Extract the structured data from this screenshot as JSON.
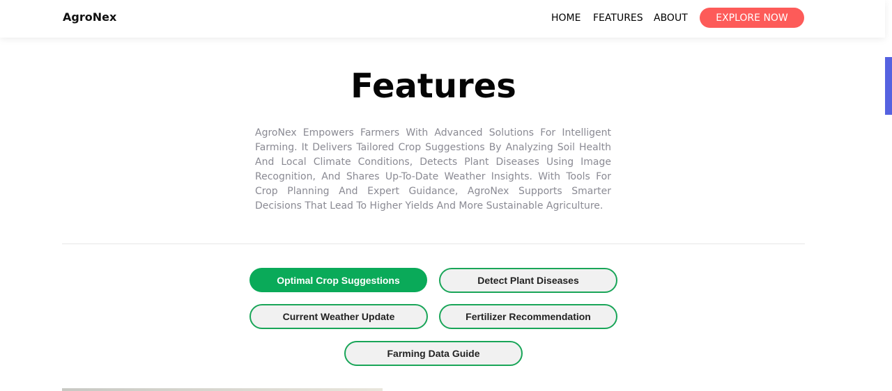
{
  "nav": {
    "brand": "AgroNex",
    "links": [
      "HOME",
      "FEATURES",
      "ABOUT"
    ],
    "cta": "EXPLORE NOW"
  },
  "features": {
    "heading": "Features",
    "description": "AgroNex Empowers Farmers With Advanced Solutions For Intelligent Farming. It Delivers Tailored Crop Suggestions By Analyzing Soil Health And Local Climate Conditions, Detects Plant Diseases Using Image Recognition, And Shares Up-To-Date Weather Insights. With Tools For Crop Planning And Expert Guidance, AgroNex Supports Smarter Decisions That Lead To Higher Yields And More Sustainable Agriculture.",
    "tabs": [
      {
        "label": "Optimal Crop Suggestions",
        "active": true
      },
      {
        "label": "Detect Plant Diseases",
        "active": false
      },
      {
        "label": "Current Weather Update",
        "active": false
      },
      {
        "label": "Fertilizer Recommendation",
        "active": false
      },
      {
        "label": "Farming Data Guide",
        "active": false
      }
    ]
  },
  "colors": {
    "accent_green": "#0aaa59",
    "cta_red": "#fd5b59",
    "scroll_accent": "#5562e0"
  }
}
